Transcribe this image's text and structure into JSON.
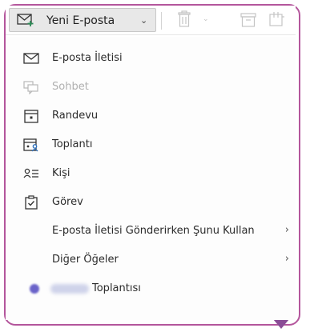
{
  "toolbar": {
    "new_email_label": "Yeni E-posta",
    "new_email_chevron": "⌄",
    "icons": [
      "mail-plus-icon",
      "trash-icon",
      "archive-icon",
      "move-icon"
    ]
  },
  "menu": {
    "items": [
      {
        "label": "E-posta İletisi",
        "icon": "envelope-icon",
        "enabled": true
      },
      {
        "label": "Sohbet",
        "icon": "chat-icon",
        "enabled": false
      },
      {
        "label": "Randevu",
        "icon": "calendar-icon",
        "enabled": true
      },
      {
        "label": "Toplantı",
        "icon": "meeting-icon",
        "enabled": true
      },
      {
        "label": "Kişi",
        "icon": "contact-icon",
        "enabled": true
      },
      {
        "label": "Görev",
        "icon": "task-icon",
        "enabled": true
      },
      {
        "label": "E-posta İletisi Gönderirken Şunu Kullan",
        "icon": "",
        "enabled": true,
        "submenu": true
      },
      {
        "label": "Diğer Öğeler",
        "icon": "",
        "enabled": true,
        "submenu": true
      },
      {
        "label": "Toplantısı",
        "icon": "teams-icon",
        "enabled": true
      }
    ],
    "submenu_arrow": "›"
  },
  "colors": {
    "frame": "#b4569c",
    "pointer": "#8a4c96",
    "accent_green": "#2e8b57",
    "teams_purple": "#6a63c9",
    "button_bg": "#e8e8e8"
  }
}
